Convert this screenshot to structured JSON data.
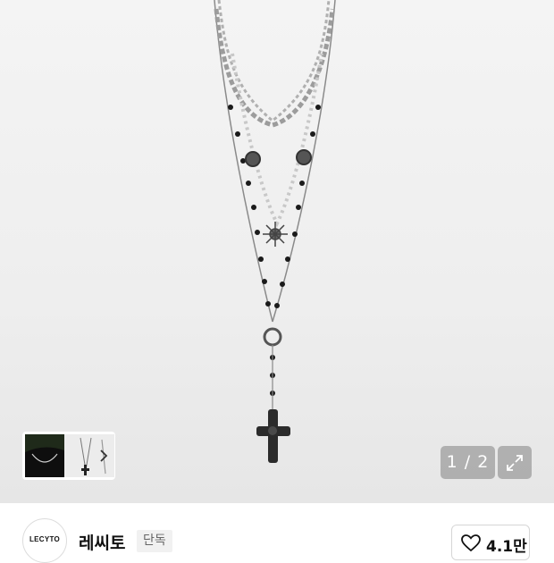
{
  "gallery": {
    "current_page": 1,
    "total_pages": 2,
    "pager_text": "1 / 2"
  },
  "brand": {
    "logo_text": "LECYTO",
    "name": "레씨토",
    "badge": "단독"
  },
  "like": {
    "count_text": "4.1만"
  },
  "colors": {
    "accent_text": "#111111",
    "pager_bg": "#8a8a8a",
    "badge_bg": "#f1f1f1"
  }
}
